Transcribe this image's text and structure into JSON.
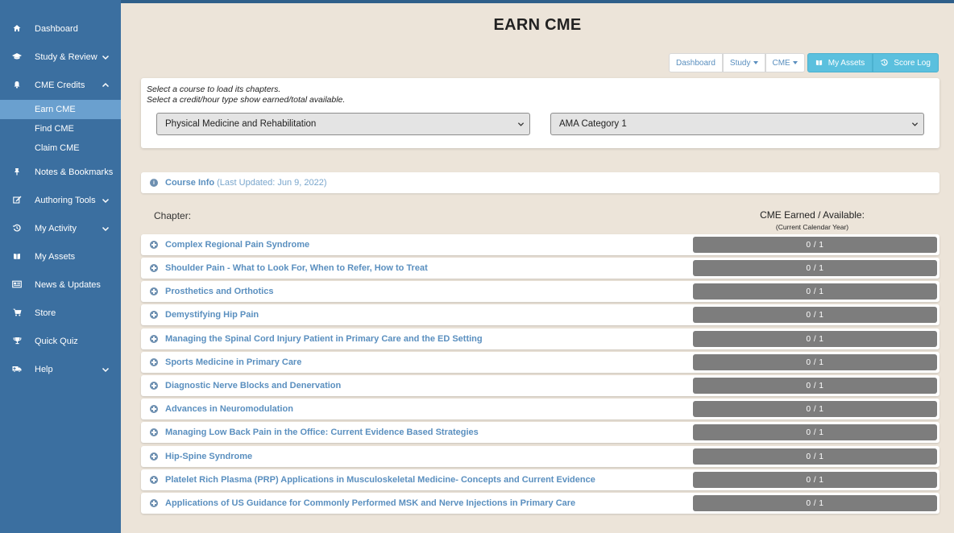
{
  "sidebar": {
    "items": [
      {
        "label": "Dashboard",
        "icon": "home-icon"
      },
      {
        "label": "Study & Review",
        "icon": "graduation-cap-icon"
      },
      {
        "label": "CME Credits",
        "icon": "bell-icon"
      },
      {
        "label": "Notes & Bookmarks",
        "icon": "pin-icon"
      },
      {
        "label": "Authoring Tools",
        "icon": "edit-icon"
      },
      {
        "label": "My Activity",
        "icon": "history-icon"
      },
      {
        "label": "My Assets",
        "icon": "book-icon"
      },
      {
        "label": "News & Updates",
        "icon": "newspaper-icon"
      },
      {
        "label": "Store",
        "icon": "cart-icon"
      },
      {
        "label": "Quick Quiz",
        "icon": "trophy-icon"
      },
      {
        "label": "Help",
        "icon": "ambulance-icon"
      }
    ],
    "cme_sub": [
      {
        "label": "Earn CME",
        "active": true
      },
      {
        "label": "Find CME",
        "active": false
      },
      {
        "label": "Claim CME",
        "active": false
      }
    ]
  },
  "page": {
    "title": "EARN CME"
  },
  "toolbar": {
    "dashboard": "Dashboard",
    "study": "Study",
    "cme": "CME",
    "my_assets": "My Assets",
    "score_log": "Score Log"
  },
  "selector": {
    "instruction_1": "Select a course to load its chapters.",
    "instruction_2": "Select a credit/hour type show earned/total available.",
    "course": "Physical Medicine and Rehabilitation",
    "credit_type": "AMA Category 1"
  },
  "course_info": {
    "label": "Course Info",
    "updated": "(Last Updated: Jun 9, 2022)"
  },
  "table": {
    "chapter_header": "Chapter:",
    "cme_header": "CME Earned / Available:",
    "cme_subheader": "(Current Calendar Year)"
  },
  "chapters": [
    {
      "title": "Complex Regional Pain Syndrome",
      "earned": 0,
      "available": 1,
      "text": "0 / 1"
    },
    {
      "title": "Shoulder Pain - What to Look For, When to Refer, How to Treat",
      "earned": 0,
      "available": 1,
      "text": "0 / 1"
    },
    {
      "title": "Prosthetics and Orthotics",
      "earned": 0,
      "available": 1,
      "text": "0 / 1"
    },
    {
      "title": "Demystifying Hip Pain",
      "earned": 0,
      "available": 1,
      "text": "0 / 1"
    },
    {
      "title": "Managing the Spinal Cord Injury Patient in Primary Care and the ED Setting",
      "earned": 0,
      "available": 1,
      "text": "0 / 1"
    },
    {
      "title": "Sports Medicine in Primary Care",
      "earned": 0,
      "available": 1,
      "text": "0 / 1"
    },
    {
      "title": "Diagnostic Nerve Blocks and Denervation",
      "earned": 0,
      "available": 1,
      "text": "0 / 1"
    },
    {
      "title": "Advances in Neuromodulation",
      "earned": 0,
      "available": 1,
      "text": "0 / 1"
    },
    {
      "title": "Managing Low Back Pain in the Office: Current Evidence Based Strategies",
      "earned": 0,
      "available": 1,
      "text": "0 / 1"
    },
    {
      "title": "Hip-Spine Syndrome",
      "earned": 0,
      "available": 1,
      "text": "0 / 1"
    },
    {
      "title": "Platelet Rich Plasma (PRP) Applications in Musculoskeletal Medicine- Concepts and Current Evidence",
      "earned": 0,
      "available": 1,
      "text": "0 / 1"
    },
    {
      "title": "Applications of US Guidance for Commonly Performed MSK and Nerve Injections in Primary Care",
      "earned": 0,
      "available": 1,
      "text": "0 / 1"
    }
  ],
  "colors": {
    "sidebar_bg": "#3b6fa0",
    "sidebar_active": "#6aa0cf",
    "link": "#5a8fbf",
    "info_button": "#5bc0de",
    "progress_bg": "#7d7d7d",
    "page_bg": "#ece4d9"
  }
}
